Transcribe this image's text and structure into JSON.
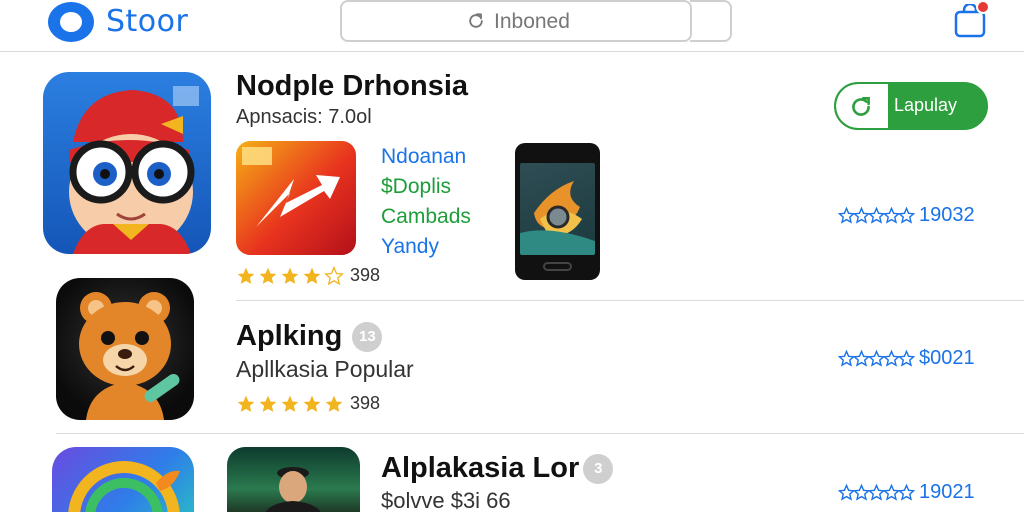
{
  "header": {
    "logo_text": "Stoor",
    "search_placeholder": "Inboned"
  },
  "featured": {
    "title": "Nodple Drhonsia",
    "subtitle": "Apnsacis: 7.0ol",
    "install_label": "Lapulay",
    "links": [
      "Ndoanan",
      "$Doplis",
      "Cambads",
      "Yandy"
    ],
    "stars": 4,
    "star_count": "398",
    "rating_text": "19032"
  },
  "apps": [
    {
      "title": "Aplking",
      "badge": "13",
      "subtitle": "Apllkasia Popular",
      "stars": 5,
      "star_count": "398",
      "rating_text": "$0021"
    },
    {
      "title": "Alplakasia Lor",
      "badge": "3",
      "subtitle": "$olvve $3i 66",
      "rating_text": "19021"
    }
  ],
  "colors": {
    "accent": "#1a73e8",
    "install_green": "#2e9f3e",
    "star_gold": "#f2b41f",
    "notification_red": "#e53935"
  },
  "icons": {
    "logo": "logo-mark-icon",
    "search": "refresh-icon",
    "notification": "bag-notification-icon",
    "install": "refresh-icon",
    "star": "star-icon"
  }
}
